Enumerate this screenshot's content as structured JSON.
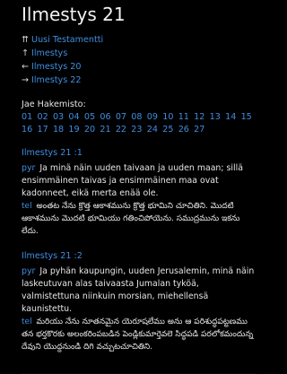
{
  "header": {
    "title": "Ilmestys 21"
  },
  "nav": [
    {
      "icon": "double-up-arrow-icon",
      "glyph": "⇈",
      "label": "Uusi Testamentti"
    },
    {
      "icon": "up-arrow-icon",
      "glyph": "↑",
      "label": "Ilmestys"
    },
    {
      "icon": "left-arrow-icon",
      "glyph": "←",
      "label": "Ilmestys 20"
    },
    {
      "icon": "right-arrow-icon",
      "glyph": "→",
      "label": "Ilmestys 22"
    }
  ],
  "chapter_index": {
    "label": "Jae Hakemisto:",
    "numbers": [
      "01",
      "02",
      "03",
      "04",
      "05",
      "06",
      "07",
      "08",
      "09",
      "10",
      "11",
      "12",
      "13",
      "14",
      "15",
      "16",
      "17",
      "18",
      "19",
      "20",
      "21",
      "22",
      "23",
      "24",
      "25",
      "26",
      "27"
    ]
  },
  "verses": [
    {
      "ref": "Ilmestys 21 :1",
      "pyr_code": "pyr",
      "pyr_text": "Ja minä näin uuden taivaan ja uuden maan; sillä ensimmäinen taivas ja ensimmäinen maa ovat kadonneet, eikä merta enää ole.",
      "tel_code": "tel",
      "tel_text": "అంతట నేను క్రొత్త ఆకాశమును క్రొత్త భూమిని చూచితిని. మొదటి ఆకాశమును మొదటి భూమియు గతించిపోయెను. సముద్రమును ఇకను లేదు."
    },
    {
      "ref": "Ilmestys 21 :2",
      "pyr_code": "pyr",
      "pyr_text": "Ja pyhän kaupungin, uuden Jerusalemin, minä näin laskeutuvan alas taivaasta Jumalan tyköä, valmistettuna niinkuin morsian, miehellensä kaunistettu.",
      "tel_code": "tel",
      "tel_text": "మరియు నేను నూతనమైన యెరూషలేము అను ఆ పరిశుద్ధపట్టణము తన భర్తకొరకు అలంకరింపబడిన పెండ్లికుమార్తెవలె సిద్ధపడి పరలోకమందున్న దేవుని యొద్దనుండి దిగి వచ్చుటచూచితిని."
    }
  ]
}
